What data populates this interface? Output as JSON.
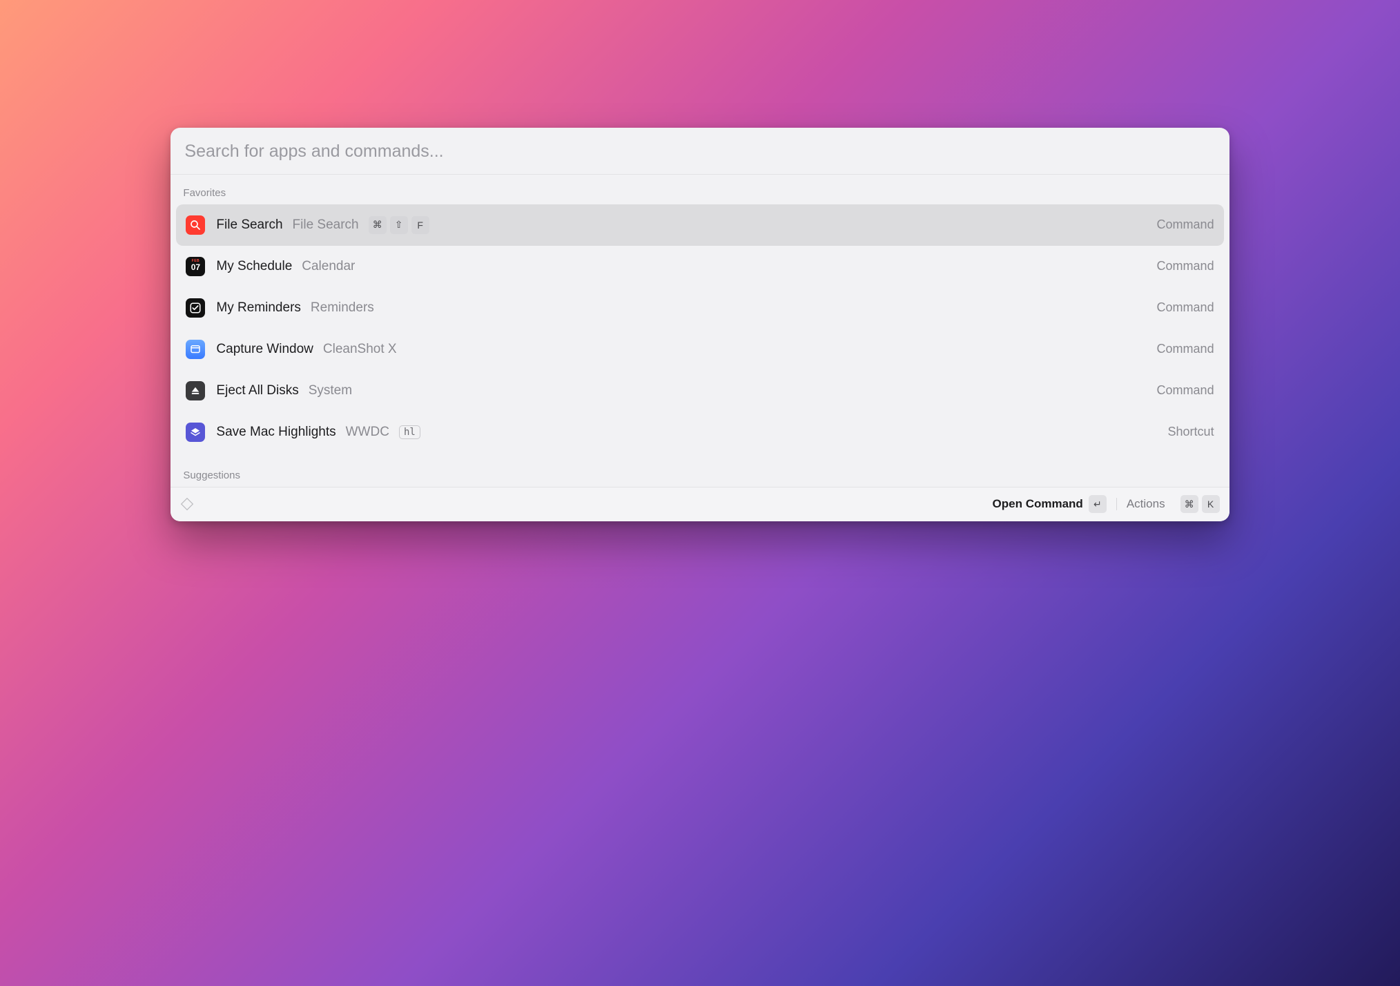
{
  "search": {
    "placeholder": "Search for apps and commands..."
  },
  "sections": {
    "favorites_label": "Favorites",
    "suggestions_label": "Suggestions"
  },
  "items": [
    {
      "icon": "search",
      "title": "File Search",
      "subtitle": "File Search",
      "keys": [
        "⌘",
        "⇧",
        "F"
      ],
      "badge": null,
      "meta": "Command",
      "selected": true
    },
    {
      "icon": "calendar",
      "title": "My Schedule",
      "subtitle": "Calendar",
      "keys": [],
      "badge": null,
      "meta": "Command",
      "selected": false,
      "cal": {
        "month": "FEB",
        "day": "07"
      }
    },
    {
      "icon": "check",
      "title": "My Reminders",
      "subtitle": "Reminders",
      "keys": [],
      "badge": null,
      "meta": "Command",
      "selected": false
    },
    {
      "icon": "window",
      "title": "Capture Window",
      "subtitle": "CleanShot X",
      "keys": [],
      "badge": null,
      "meta": "Command",
      "selected": false
    },
    {
      "icon": "eject",
      "title": "Eject All Disks",
      "subtitle": "System",
      "keys": [],
      "badge": null,
      "meta": "Command",
      "selected": false
    },
    {
      "icon": "layers",
      "title": "Save Mac Highlights",
      "subtitle": "WWDC",
      "keys": [],
      "badge": "hl",
      "meta": "Shortcut",
      "selected": false
    }
  ],
  "footer": {
    "primary_label": "Open Command",
    "primary_key": "↵",
    "actions_label": "Actions",
    "actions_keys": [
      "⌘",
      "K"
    ]
  }
}
